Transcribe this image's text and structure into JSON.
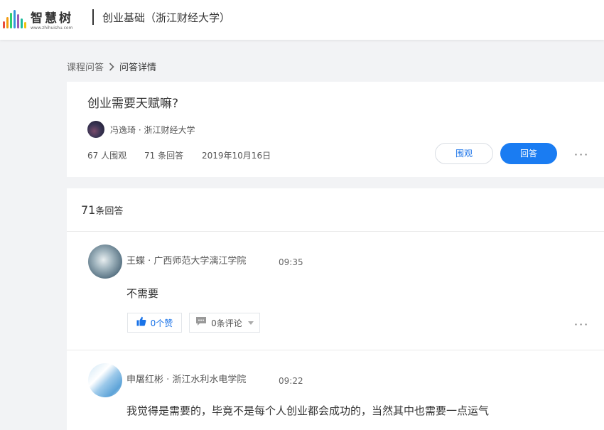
{
  "header": {
    "logo_text": "智慧树",
    "logo_subtext": "www.zhihuishu.com",
    "course_title": "创业基础（浙江财经大学）",
    "logo_colors": [
      "#e94b3c",
      "#f39c12",
      "#2ecc71",
      "#3498db",
      "#9b59b6",
      "#1abc9c",
      "#f1c40f"
    ]
  },
  "breadcrumb": {
    "parent": "课程问答",
    "separator": "›",
    "current": "问答详情"
  },
  "question": {
    "title": "创业需要天赋嘛?",
    "author": "冯逸琦 · 浙江财经大学",
    "views": "67  人围观",
    "answers": "71  条回答",
    "date": "2019年10月16日",
    "watch_label": "围观",
    "answer_label": "回答",
    "more": "···"
  },
  "answers_section": {
    "count_num": "71",
    "count_label": "条回答",
    "items": [
      {
        "author": "王蝶 · 广西师范大学漓江学院",
        "time": "09:35",
        "body": "不需要",
        "like_label": "0个赞",
        "comment_label": "0条评论",
        "more": "···"
      },
      {
        "author": "申屠红彬 · 浙江水利水电学院",
        "time": "09:22",
        "body": "我觉得是需要的，毕竟不是每个人创业都会成功的，当然其中也需要一点运气"
      }
    ]
  },
  "colors": {
    "accent": "#1a7cf2",
    "link": "#1a73e8",
    "background": "#f2f3f5"
  }
}
